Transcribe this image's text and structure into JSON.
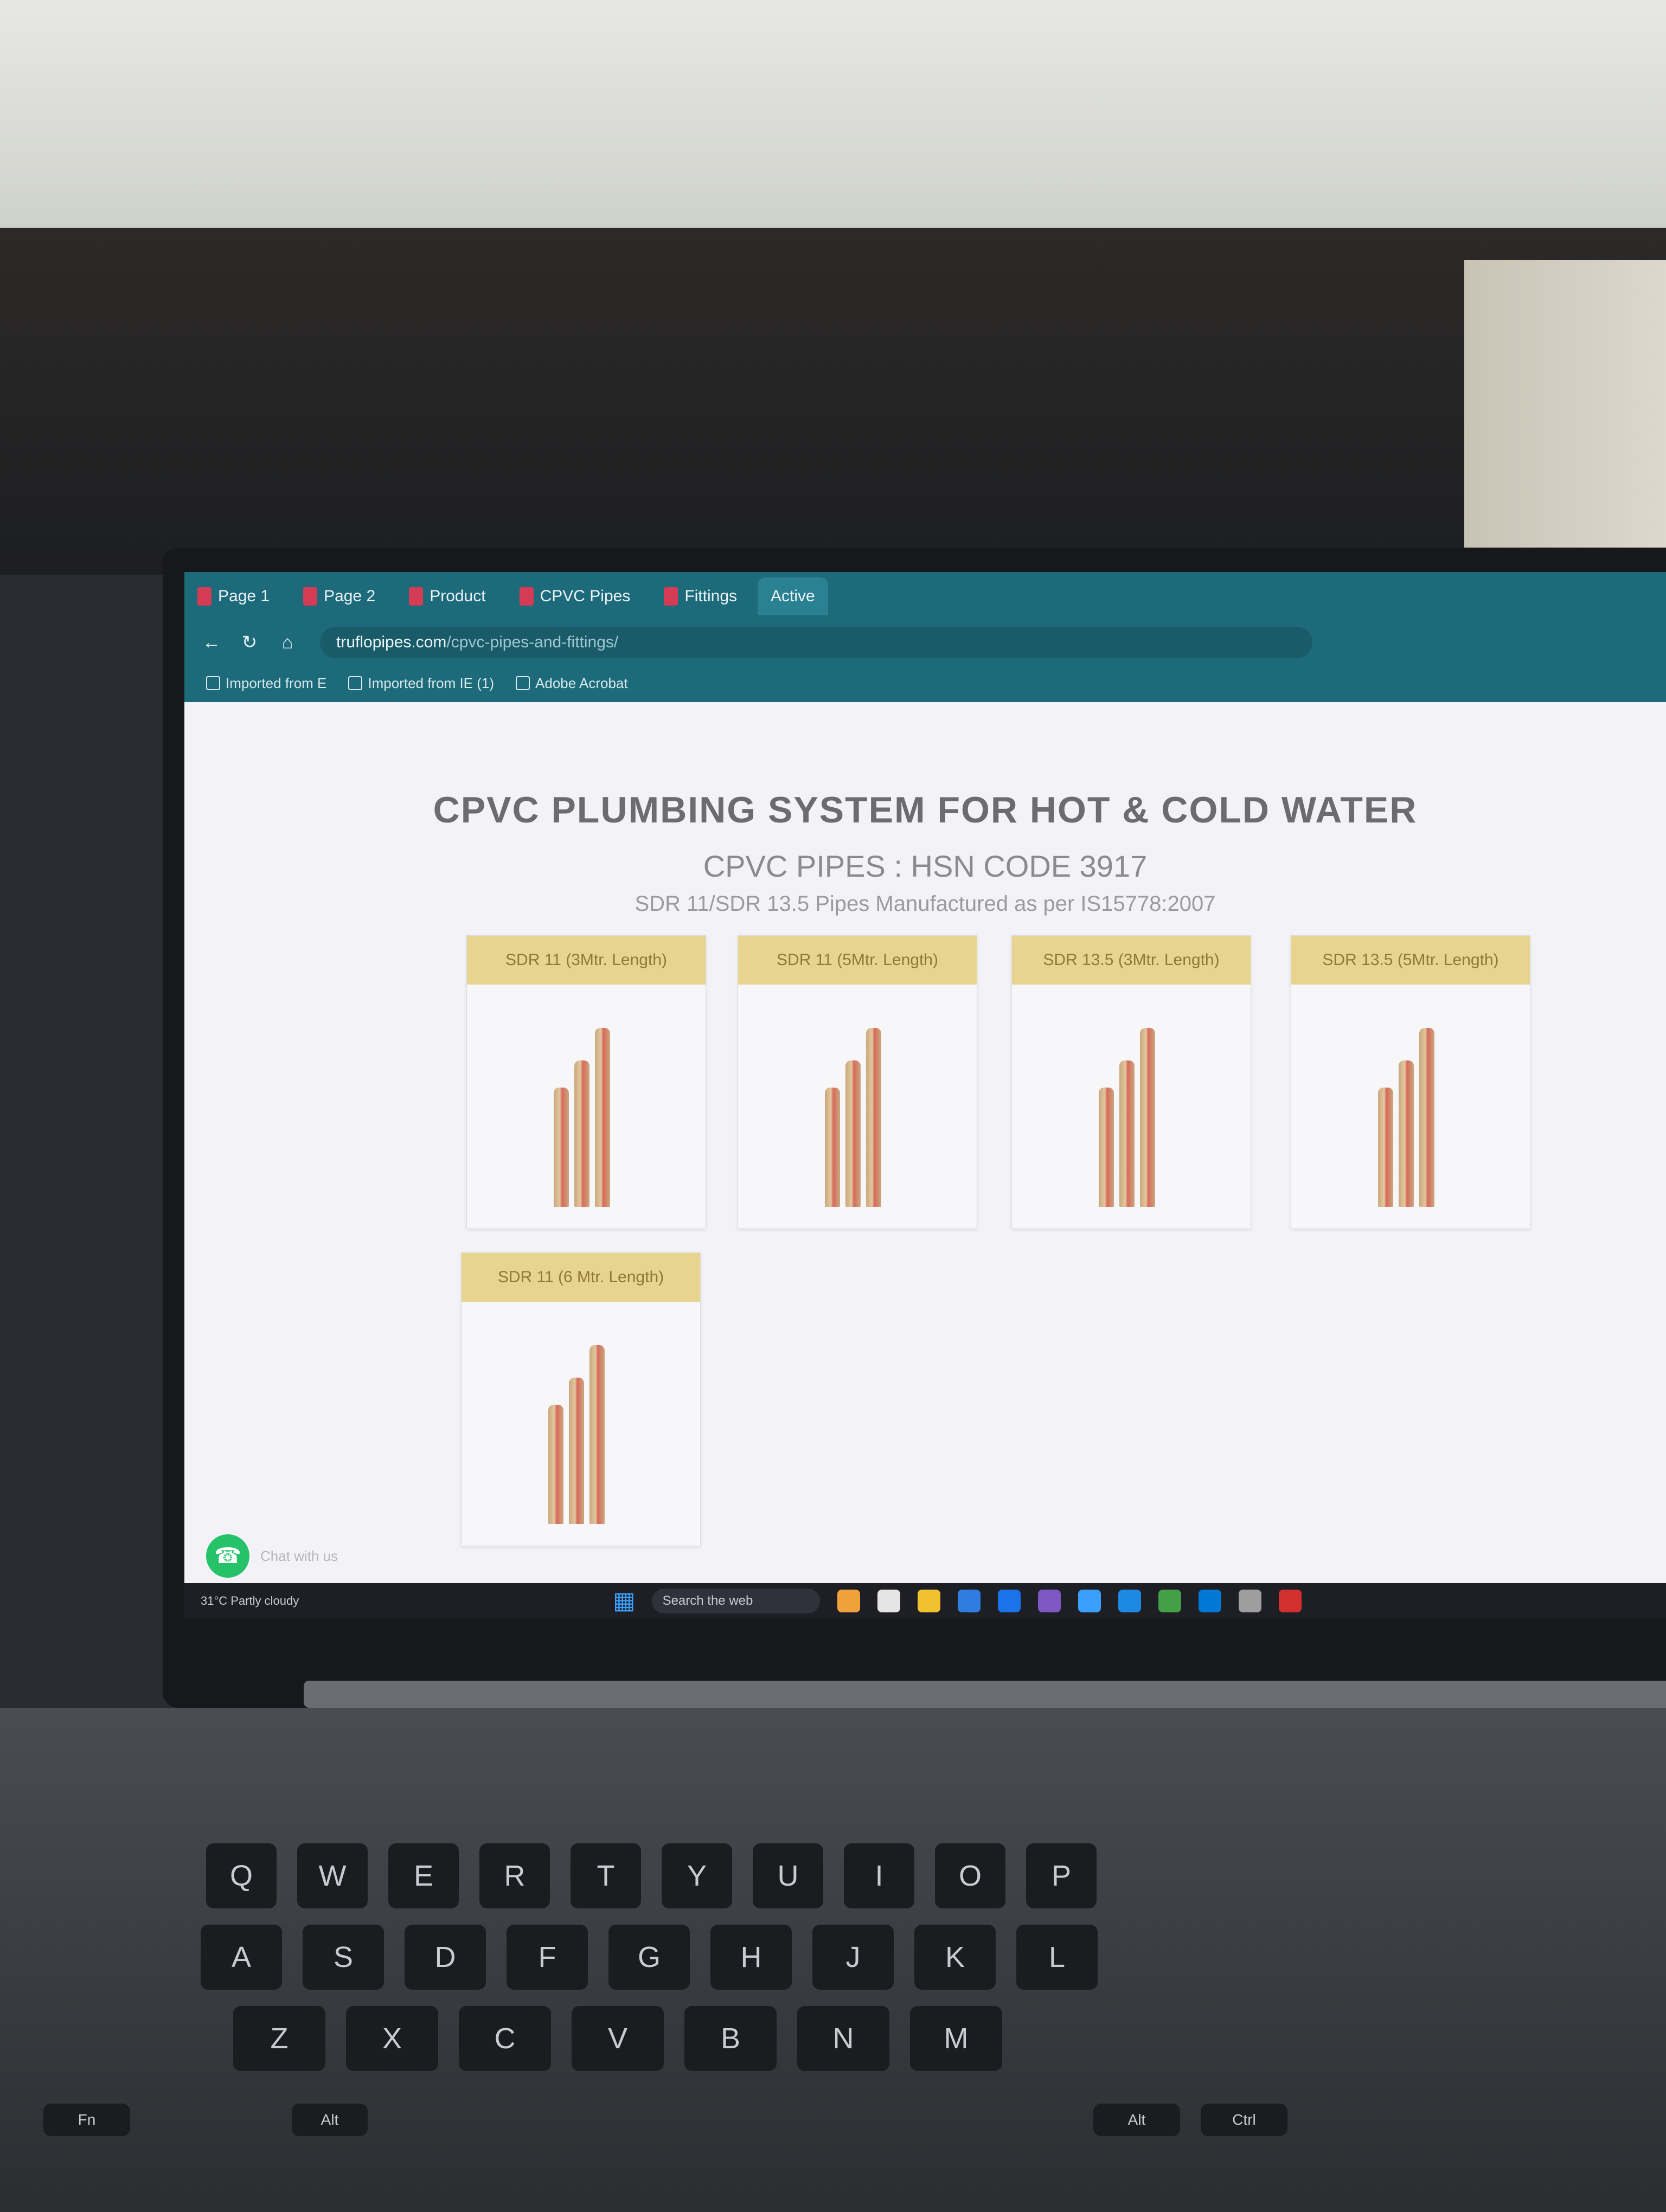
{
  "browser": {
    "tabs": [
      {
        "label": "Page 1"
      },
      {
        "label": "Page 2"
      },
      {
        "label": "Product"
      },
      {
        "label": "CPVC Pipes"
      },
      {
        "label": "Fittings"
      },
      {
        "label": "Active"
      }
    ],
    "address": {
      "domain": "truflopipes.com",
      "path": "/cpvc-pipes-and-fittings/"
    },
    "bookmarks": [
      "Imported from E",
      "Imported from IE (1)",
      "Adobe Acrobat"
    ]
  },
  "page": {
    "title": "CPVC PLUMBING SYSTEM FOR HOT & COLD WATER",
    "subtitle": "CPVC PIPES : HSN CODE 3917",
    "description": "SDR 11/SDR 13.5 Pipes Manufactured as per IS15778:2007",
    "products": [
      {
        "label": "SDR 11 (3Mtr. Length)"
      },
      {
        "label": "SDR 11 (5Mtr. Length)"
      },
      {
        "label": "SDR 13.5 (3Mtr. Length)"
      },
      {
        "label": "SDR 13.5 (5Mtr. Length)"
      },
      {
        "label": "SDR 11 (6 Mtr. Length)"
      }
    ],
    "whatsapp": {
      "label": "Chat with us"
    }
  },
  "taskbar": {
    "weather": "31°C Partly cloudy",
    "search_placeholder": "Search the web"
  },
  "keyboard": {
    "row1": [
      "Q",
      "W",
      "E",
      "R",
      "T",
      "Y",
      "U",
      "I",
      "O",
      "P"
    ],
    "row2": [
      "A",
      "S",
      "D",
      "F",
      "G",
      "H",
      "J",
      "K",
      "L"
    ],
    "row3": [
      "Z",
      "X",
      "C",
      "V",
      "B",
      "N",
      "M"
    ],
    "row4": [
      "Fn",
      "Alt",
      "Alt",
      "Ctrl"
    ]
  },
  "colors": {
    "chrome": "#1d6a7a",
    "card_header": "#e7d48e",
    "whatsapp": "#25c26a"
  }
}
